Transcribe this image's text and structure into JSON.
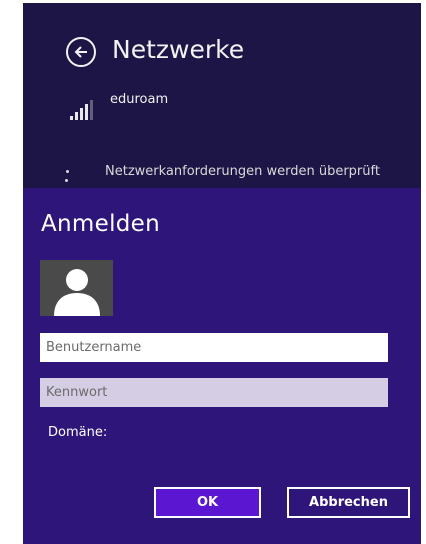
{
  "background": {
    "title": "Netzwerke",
    "network_name": "eduroam",
    "status_text": "Netzwerkanforderungen werden überprüft"
  },
  "dialog": {
    "heading": "Anmelden",
    "username_placeholder": "Benutzername",
    "password_placeholder": "Kennwort",
    "domain_label": "Domäne:",
    "ok_label": "OK",
    "cancel_label": "Abbrechen"
  },
  "colors": {
    "page_background": "#1d1545",
    "dialog_background": "#2e1579",
    "ok_button": "#5a16d0"
  },
  "icons": {
    "back": "back-arrow-icon",
    "signal": "wifi-signal-icon",
    "avatar": "user-avatar-icon"
  }
}
